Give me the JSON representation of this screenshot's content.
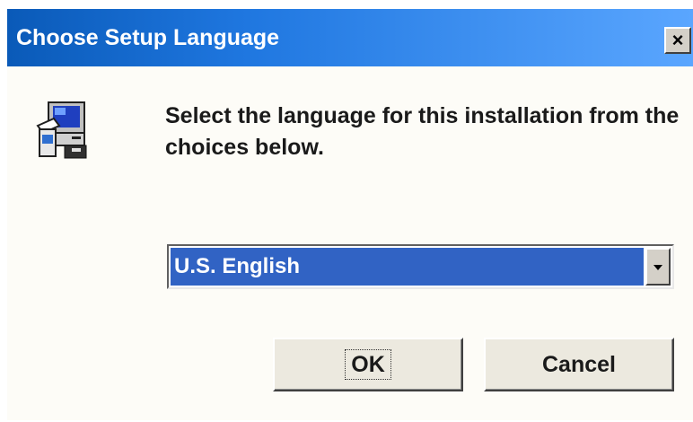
{
  "window": {
    "title": "Choose Setup Language",
    "close_glyph": "×"
  },
  "setup_icon": {
    "name": "computer-setup-icon"
  },
  "prompt": {
    "text": "Select the language for this installation from the choices below."
  },
  "language_select": {
    "selected": "U.S. English"
  },
  "buttons": {
    "ok_label": "OK",
    "cancel_label": "Cancel"
  },
  "colors": {
    "titlebar_start": "#0a5ab8",
    "titlebar_end": "#5aa6ff",
    "selection": "#3163c4",
    "dialog_bg": "#fdfcf7",
    "button_face": "#ece9df"
  }
}
